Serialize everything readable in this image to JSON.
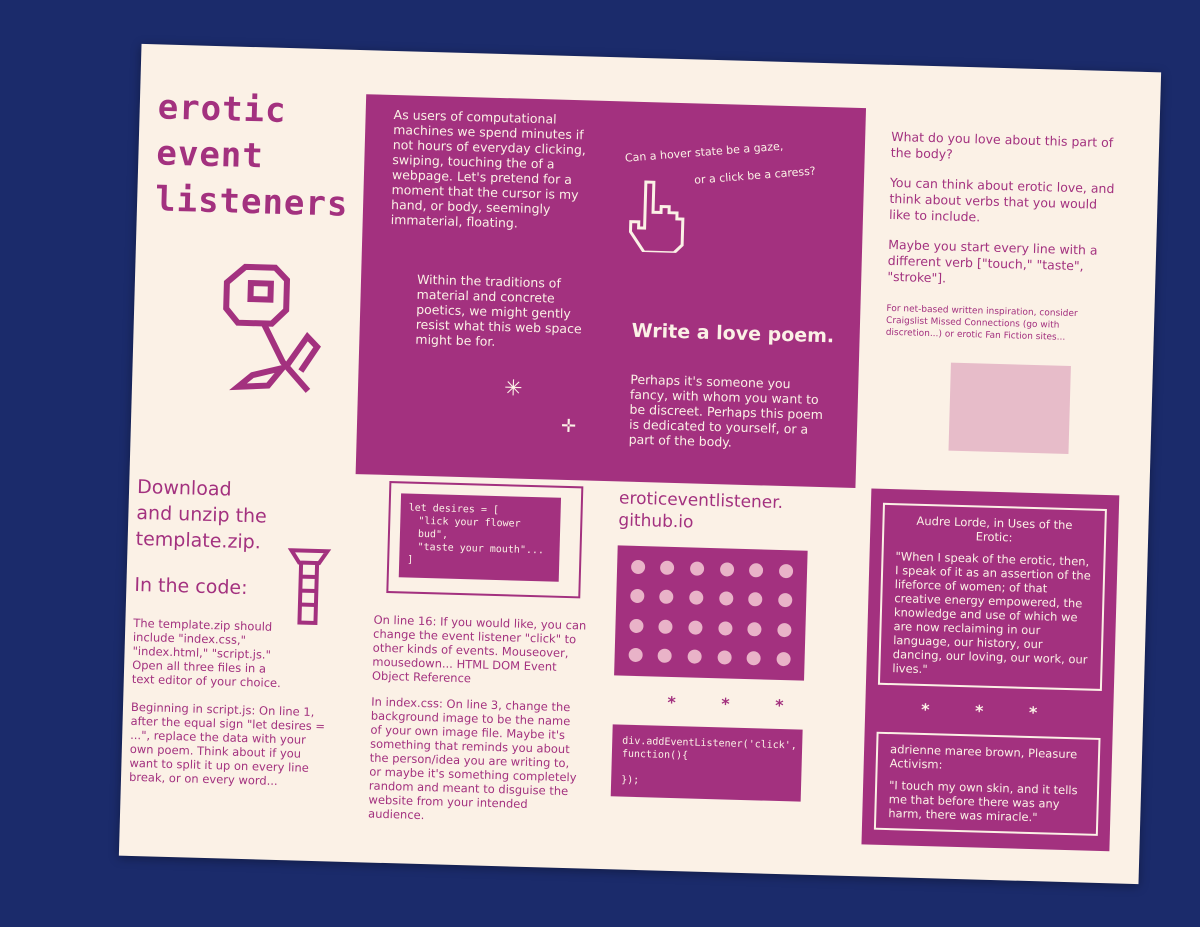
{
  "title": [
    "erotic",
    "event",
    "listeners"
  ],
  "intro_panel": {
    "para1": "As users of computational machines we spend minutes if not hours of everyday clicking, swiping, touching the of a webpage. Let's pretend for a moment that the cursor is my hand, or body, seemingly immaterial, floating.",
    "question_line1": "Can a hover state be a gaze,",
    "question_line2": "or a click be a caress?",
    "para2": "Within the traditions of material and concrete poetics, we might gently resist what this web space might be for.",
    "heading": "Write a love poem.",
    "para3": "Perhaps it's someone you fancy, with whom you want to be discreet. Perhaps this poem is dedicated to yourself, or a part of the body."
  },
  "right_column": {
    "q1": "What do you love about this part of the body?",
    "q2": "You can think about erotic love, and think about verbs that you would like to include.",
    "q3": "Maybe you start every line with a different verb [\"touch,\" \"taste\", \"stroke\"].",
    "small_note": "For net-based written inspiration, consider Craigslist Missed Connections (go with discretion...) or erotic Fan Fiction sites..."
  },
  "download": {
    "heading_lines": [
      "Download",
      "and unzip the",
      "template.zip."
    ],
    "code_heading": "In the code:",
    "para1": "The template.zip should include \"index.css,\" \"index.html,\" \"script.js.\" Open all three files in a text editor of your choice.",
    "para2": "Beginning in script.js: On line 1, after the equal sign \"let desires = ...\", replace the data with your own poem. Think about if you want to split it up on every line break, or on every word..."
  },
  "code_sample": {
    "lines": [
      "let desires = [",
      "\"lick your flower bud\",",
      "\"taste your mouth\"...",
      "]"
    ]
  },
  "instructions": {
    "para1": "On line 16: If you would like, you can change the event listener \"click\" to other kinds of events. Mouseover, mousedown... HTML DOM Event Object Reference",
    "para2": "In index.css: On line 3, change the background image to be the name of your own image file. Maybe it's something that reminds you about the person/idea you are writing to, or maybe it's something completely random and meant to disguise the website from your intended audience."
  },
  "site": {
    "url_lines": [
      "eroticeventlistener.",
      "github.io"
    ],
    "stars": "* * *",
    "code_lines": [
      "div.addEventListener('click',",
      "function(){",
      "",
      "});"
    ]
  },
  "quotes": {
    "q1_heading": "Audre Lorde, in Uses of the Erotic:",
    "q1_text": "\"When I speak of the erotic, then, I speak of it as an assertion of the lifeforce of women; of that creative energy empowered, the knowledge and use of which we are now reclaiming in our language, our history, our dancing, our loving, our work, our lives.\"",
    "stars": "* * *",
    "q2_heading": "adrienne maree brown, Pleasure Activism:",
    "q2_text": "\"I touch my own skin, and it tells me that before there was any harm, there was miracle.\""
  },
  "colors": {
    "accent": "#a3317f",
    "paper": "#fbf1e6",
    "background": "#1b2b6b"
  }
}
